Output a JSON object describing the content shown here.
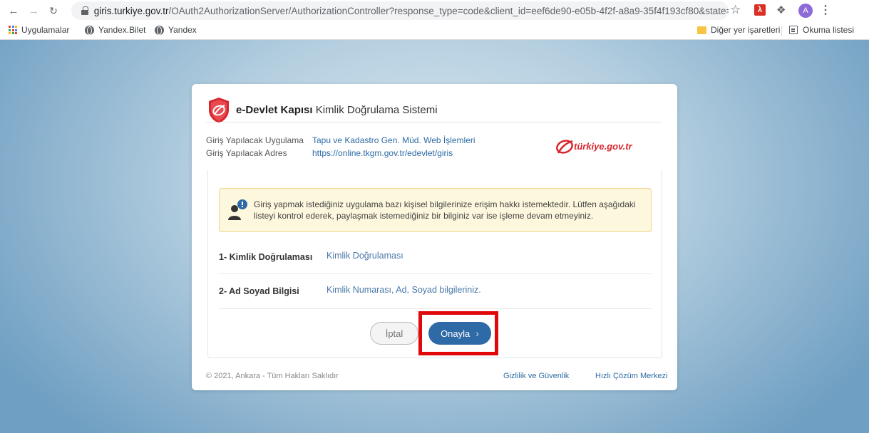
{
  "browser": {
    "url_host": "giris.turkiye.gov.tr",
    "url_rest": "/OAuth2AuthorizationServer/AuthorizationController?response_type=code&client_id=eef6de90-e05b-4f2f-a8a9-35f4f193cf80&state=e...",
    "avatar_letter": "A",
    "icons": [
      "back-arrow-icon",
      "forward-arrow-icon",
      "reload-icon",
      "lock-icon",
      "star-icon",
      "pdf-extension-icon",
      "puzzle-icon",
      "menu-dots-icon"
    ]
  },
  "bookmarks": {
    "apps": "Uygulamalar",
    "yandex_bilet": "Yandex.Bilet",
    "yandex": "Yandex",
    "other": "Diğer yer işaretleri",
    "reading_list": "Okuma listesi"
  },
  "card": {
    "title_bold": "e-Devlet Kapısı",
    "title_rest": " Kimlik Doğrulama Sistemi",
    "app_label": "Giriş Yapılacak Uygulama",
    "app_value": "Tapu ve Kadastro Gen. Müd. Web İşlemleri",
    "addr_label": "Giriş Yapılacak Adres",
    "addr_value": "https://online.tkgm.gov.tr/edevlet/giris",
    "tr_logo_text": "türkiye.gov.tr",
    "alert_text": "Giriş yapmak istediğiniz uygulama bazı kişisel bilgilerinize erişim hakkı istemektedir. Lütfen aşağıdaki listeyi kontrol ederek, paylaşmak istemediğiniz bir bilginiz var ise işleme devam etmeyiniz.",
    "rows": [
      {
        "label": "1- Kimlik Doğrulaması",
        "value": "Kimlik Doğrulaması"
      },
      {
        "label": "2- Ad Soyad Bilgisi",
        "value": "Kimlik Numarası, Ad, Soyad bilgileriniz."
      }
    ],
    "cancel_label": "İptal",
    "approve_label": "Onayla",
    "approve_chevron": "›",
    "footer_copyright": "© 2021, Ankara - Tüm Hakları Saklıdır",
    "footer_privacy": "Gizlilik ve Güvenlik",
    "footer_help": "Hızlı Çözüm Merkezi"
  },
  "colors": {
    "accent": "#2e6aa5",
    "highlight": "#e0080b",
    "edevlet_red": "#d8262e"
  }
}
